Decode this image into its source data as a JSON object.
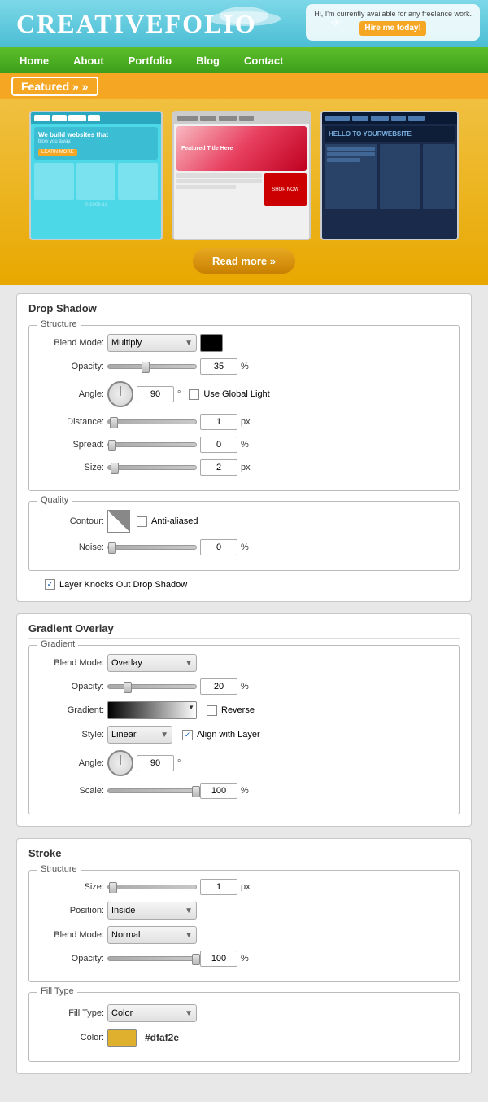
{
  "header": {
    "logo_creative": "CREATIVE",
    "logo_folio": "FOLIO",
    "hire_text": "Hi, I'm currently available for any freelance work.",
    "hire_btn": "Hire me today!"
  },
  "nav": {
    "items": [
      "Home",
      "About",
      "Portfolio",
      "Blog",
      "Contact"
    ]
  },
  "featured": {
    "label": "Featured »"
  },
  "carousel": {
    "read_more": "Read more »"
  },
  "drop_shadow": {
    "panel_title": "Drop Shadow",
    "structure_label": "Structure",
    "blend_mode_label": "Blend Mode:",
    "blend_mode_value": "Multiply",
    "opacity_label": "Opacity:",
    "opacity_value": "35",
    "angle_label": "Angle:",
    "angle_value": "90",
    "use_global_light": "Use Global Light",
    "distance_label": "Distance:",
    "distance_value": "1",
    "spread_label": "Spread:",
    "spread_value": "0",
    "size_label": "Size:",
    "size_value": "2",
    "quality_label": "Quality",
    "contour_label": "Contour:",
    "anti_aliased": "Anti-aliased",
    "noise_label": "Noise:",
    "noise_value": "0",
    "layer_knocks_label": "Layer Knocks Out Drop Shadow",
    "px": "px",
    "percent": "%"
  },
  "gradient_overlay": {
    "panel_title": "Gradient Overlay",
    "gradient_section": "Gradient",
    "blend_mode_label": "Blend Mode:",
    "blend_mode_value": "Overlay",
    "opacity_label": "Opacity:",
    "opacity_value": "20",
    "gradient_label": "Gradient:",
    "reverse_label": "Reverse",
    "style_label": "Style:",
    "style_value": "Linear",
    "align_layer": "Align with Layer",
    "angle_label": "Angle:",
    "angle_value": "90",
    "scale_label": "Scale:",
    "scale_value": "100",
    "percent": "%"
  },
  "stroke": {
    "panel_title": "Stroke",
    "structure_label": "Structure",
    "size_label": "Size:",
    "size_value": "1",
    "position_label": "Position:",
    "position_value": "Inside",
    "blend_mode_label": "Blend Mode:",
    "blend_mode_value": "Normal",
    "opacity_label": "Opacity:",
    "opacity_value": "100",
    "fill_type_label": "Fill Type:",
    "fill_type_value": "Color",
    "color_label": "Color:",
    "color_hex": "#dfaf2e",
    "px": "px",
    "percent": "%"
  }
}
